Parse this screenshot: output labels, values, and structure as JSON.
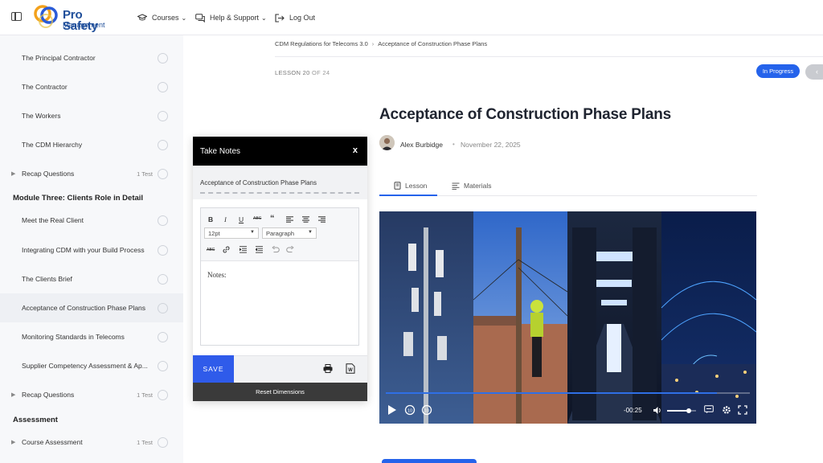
{
  "header": {
    "brand_line1": "Pro Safety",
    "brand_line2": "Management",
    "nav": [
      {
        "label": "Courses",
        "icon": "graduation-cap-icon"
      },
      {
        "label": "Help & Support",
        "icon": "chat-icon"
      },
      {
        "label": "Log Out",
        "icon": "logout-icon"
      }
    ]
  },
  "sidebar": {
    "items_top": [
      {
        "label": "The Principal Contractor"
      },
      {
        "label": "The Contractor"
      },
      {
        "label": "The Workers"
      },
      {
        "label": "The CDM Hierarchy"
      },
      {
        "label": "Recap Questions",
        "count": "1 Test"
      }
    ],
    "module_three_heading": "Module Three: Clients Role in Detail",
    "items_module_three": [
      {
        "label": "Meet the Real Client"
      },
      {
        "label": "Integrating CDM with your Build Process"
      },
      {
        "label": "The Clients Brief"
      },
      {
        "label": "Acceptance of Construction Phase Plans"
      },
      {
        "label": "Monitoring Standards in Telecoms"
      },
      {
        "label": "Supplier Competency Assessment & Ap..."
      },
      {
        "label": "Recap Questions",
        "count": "1 Test"
      }
    ],
    "assessment_heading": "Assessment",
    "items_assessment": [
      {
        "label": "Course Assessment",
        "count": "1 Test"
      }
    ]
  },
  "breadcrumb": {
    "course": "CDM Regulations for Telecoms 3.0",
    "separator": "›",
    "lesson": "Acceptance of Construction Phase Plans"
  },
  "lesson_counter": {
    "prefix": "LESSON 20",
    "suffix": "OF 24"
  },
  "status_badge": "In Progress",
  "prev_button": "‹",
  "title": "Acceptance of Construction Phase Plans",
  "author": {
    "name": "Alex Burbidge",
    "separator": "•",
    "date": "November 22, 2025"
  },
  "tabs": [
    {
      "label": "Lesson",
      "icon": "book-icon"
    },
    {
      "label": "Materials",
      "icon": "list-icon"
    }
  ],
  "video": {
    "time_remaining": "-00:25",
    "progress": 0.91,
    "volume": 0.75
  },
  "notes": {
    "header": "Take Notes",
    "close": "x",
    "title": "Acceptance of Construction Phase Plans",
    "font_size": "12pt",
    "block_format": "Paragraph",
    "placeholder": "Notes:",
    "save": "SAVE",
    "reset": "Reset Dimensions"
  },
  "colors": {
    "accent": "#2563eb",
    "brand": "#1f4e9a",
    "notes_header": "#000000"
  }
}
